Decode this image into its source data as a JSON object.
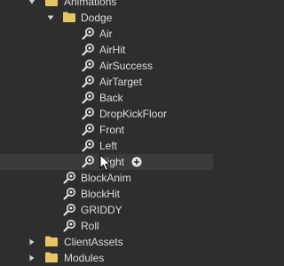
{
  "explorer": {
    "animations": {
      "label": "Animations"
    },
    "dodge": {
      "label": "Dodge",
      "items": [
        "Air",
        "AirHit",
        "AirSuccess",
        "AirTarget",
        "Back",
        "DropKickFloor",
        "Front",
        "Left",
        "Right"
      ]
    },
    "animation_items": [
      "BlockAnim",
      "BlockHit",
      "GRIDDY",
      "Roll"
    ],
    "client_assets": {
      "label": "ClientAssets"
    },
    "modules": {
      "label": "Modules"
    }
  },
  "colors": {
    "background": "#2e2e2e",
    "hover_row": "#3b3b3b",
    "folder": "#e8c564",
    "text": "#dcdcdc",
    "icon": "#e6e6e6"
  },
  "icons": {
    "folder": "folder-icon",
    "animation": "animation-icon",
    "expand": "chevron-down-icon",
    "collapse": "chevron-right-icon",
    "insert": "plus-circle-icon",
    "cursor": "mouse-pointer-icon"
  }
}
